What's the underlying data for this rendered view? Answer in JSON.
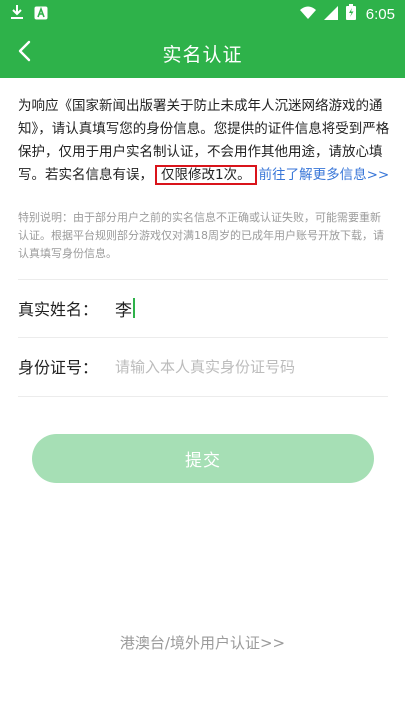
{
  "status_bar": {
    "time": "6:05",
    "icons": [
      "download-icon",
      "app-a-icon",
      "wifi-icon",
      "signal-icon",
      "battery-icon"
    ]
  },
  "header": {
    "title": "实名认证",
    "back_icon": "chevron-left-icon"
  },
  "notice": {
    "text_before": "为响应《国家新闻出版署关于防止未成年人沉迷网络游戏的通知》，请认真填写您的身份信息。您提供的证件信息将受到严格保护，仅用于用户实名制认证，不会用作其他用途，请放心填写。若实名信息有误，",
    "highlight": "仅限修改1次。",
    "link": "前往了解更多信息>>"
  },
  "special_note": "特别说明：由于部分用户之前的实名信息不正确或认证失败，可能需要重新认证。根据平台规则部分游戏仅对满18周岁的已成年用户账号开放下载，请认真填写身份信息。",
  "form": {
    "name_label": "真实姓名：",
    "name_value": "李",
    "id_label": "身份证号：",
    "id_placeholder": "请输入本人真实身份证号码"
  },
  "submit_label": "提交",
  "footer_link": "港澳台/境外用户认证>>",
  "colors": {
    "brand_green": "#2eb24a",
    "button_disabled": "#a6dfb5",
    "highlight_red": "#d9141b",
    "link_blue": "#3876d8"
  }
}
